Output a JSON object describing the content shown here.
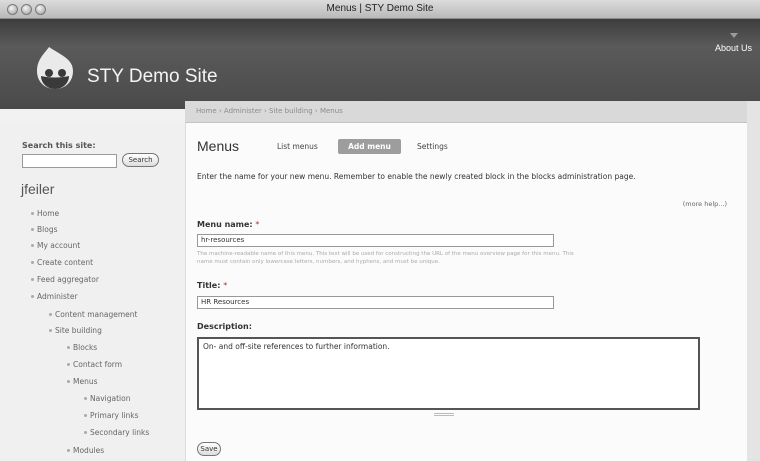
{
  "window": {
    "title": "Menus | STY Demo Site"
  },
  "header": {
    "site_name": "STY Demo Site",
    "about_link": "About Us"
  },
  "breadcrumb": {
    "text": "Home › Administer › Site building › Menus"
  },
  "sidebar": {
    "search_label": "Search this site:",
    "search_value": "",
    "search_button": "Search",
    "user_name": "jfeiler",
    "nav": {
      "home": "Home",
      "blogs": "Blogs",
      "my_account": "My account",
      "create_content": "Create content",
      "feed_aggregator": "Feed aggregator",
      "administer": "Administer",
      "content_management": "Content management",
      "site_building": "Site building",
      "blocks": "Blocks",
      "contact_form": "Contact form",
      "menus": "Menus",
      "navigation": "Navigation",
      "primary_links": "Primary links",
      "secondary_links": "Secondary links",
      "modules": "Modules"
    }
  },
  "main": {
    "page_title": "Menus",
    "tabs": {
      "list_menus": "List menus",
      "add_menu": "Add menu",
      "settings": "Settings"
    },
    "intro": "Enter the name for your new menu. Remember to enable the newly created block in the blocks administration page.",
    "more_help": "(more help...)",
    "form": {
      "menu_name_label": "Menu name:",
      "menu_name_required": "*",
      "menu_name_value": "hr-resources",
      "menu_name_desc_1": "The machine-readable name of this menu. This text will be used for constructing the URL of the menu overview page for this menu. This",
      "menu_name_desc_2": "name must contain only lowercase letters, numbers, and hyphens, and must be unique.",
      "title_label": "Title:",
      "title_required": "*",
      "title_value": "HR Resources",
      "description_label": "Description:",
      "description_value": "On- and off-site references to further information.",
      "save_button": "Save"
    }
  },
  "colors": {
    "header_bg": "#4a4a4a",
    "active_tab_bg": "#9d9d9d",
    "required_star": "#aa3333"
  }
}
